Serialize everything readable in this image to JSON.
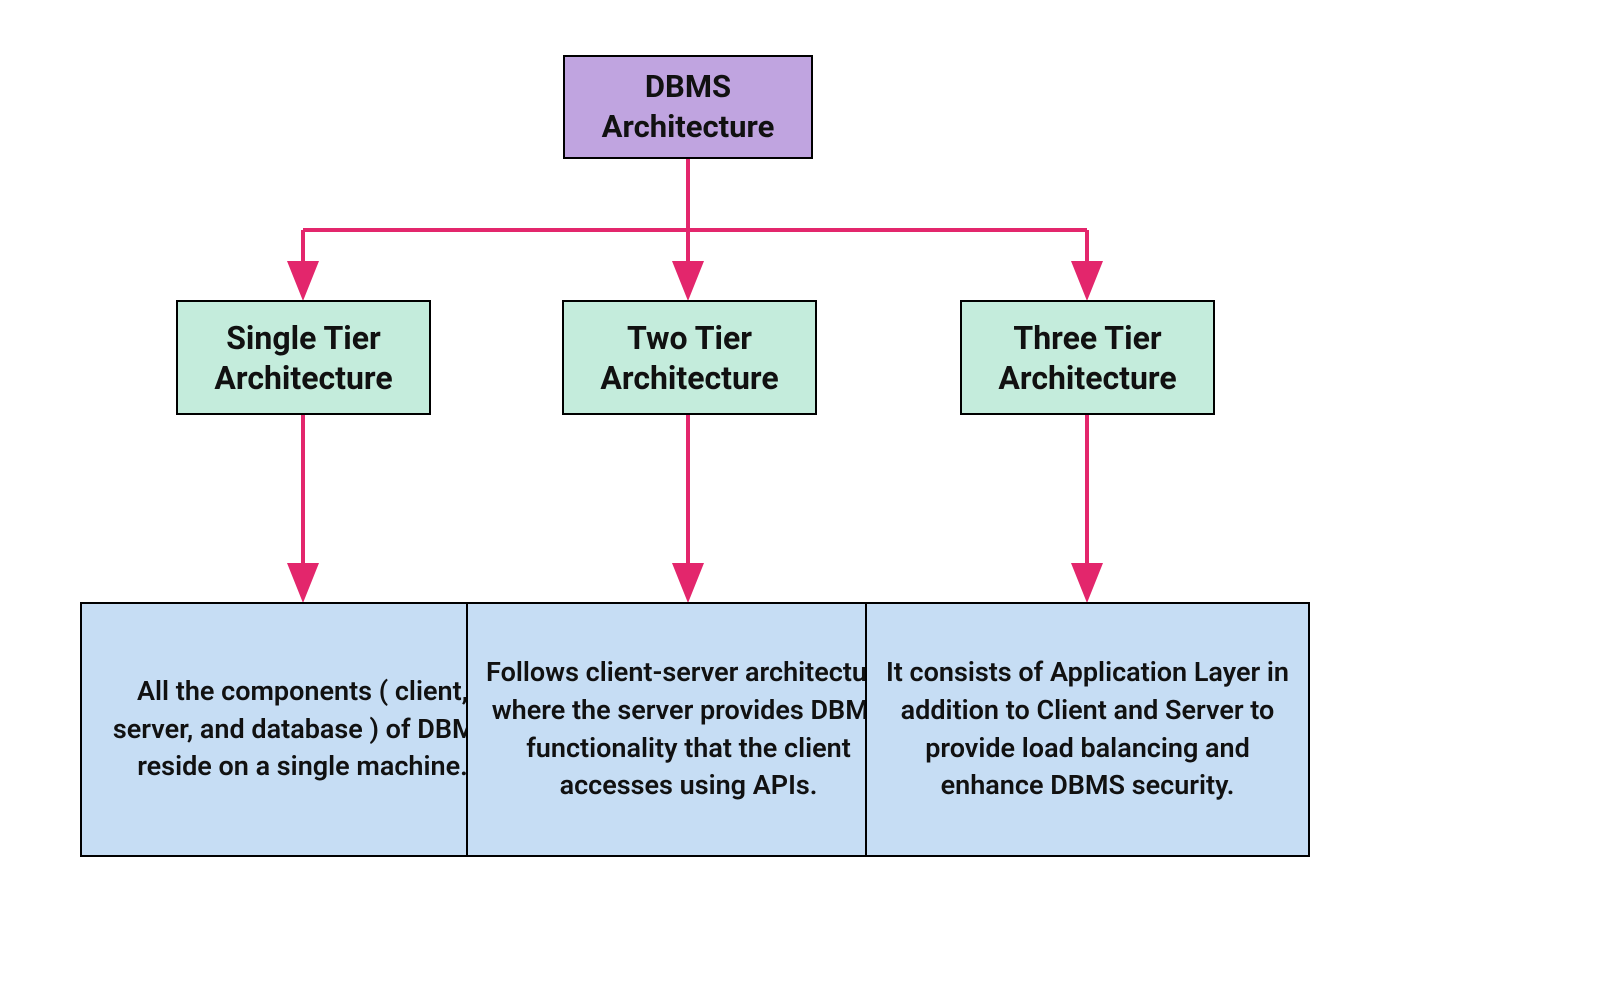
{
  "root": {
    "title": "DBMS\nArchitecture"
  },
  "tiers": [
    {
      "title": "Single Tier\nArchitecture",
      "description": "All the components ( client, server, and database ) of DBMS reside on a single machine."
    },
    {
      "title": "Two Tier\nArchitecture",
      "description": "Follows client-server architecture where the server provides DBMS functionality that the client accesses using APIs."
    },
    {
      "title": "Three Tier\nArchitecture",
      "description": "It consists of Application Layer in addition to Client and Server to provide load balancing and enhance DBMS security."
    }
  ],
  "colors": {
    "root_bg": "#c0a4e0",
    "tier_bg": "#c4ecdc",
    "desc_bg": "#c6ddf4",
    "arrow": "#e3266c"
  }
}
